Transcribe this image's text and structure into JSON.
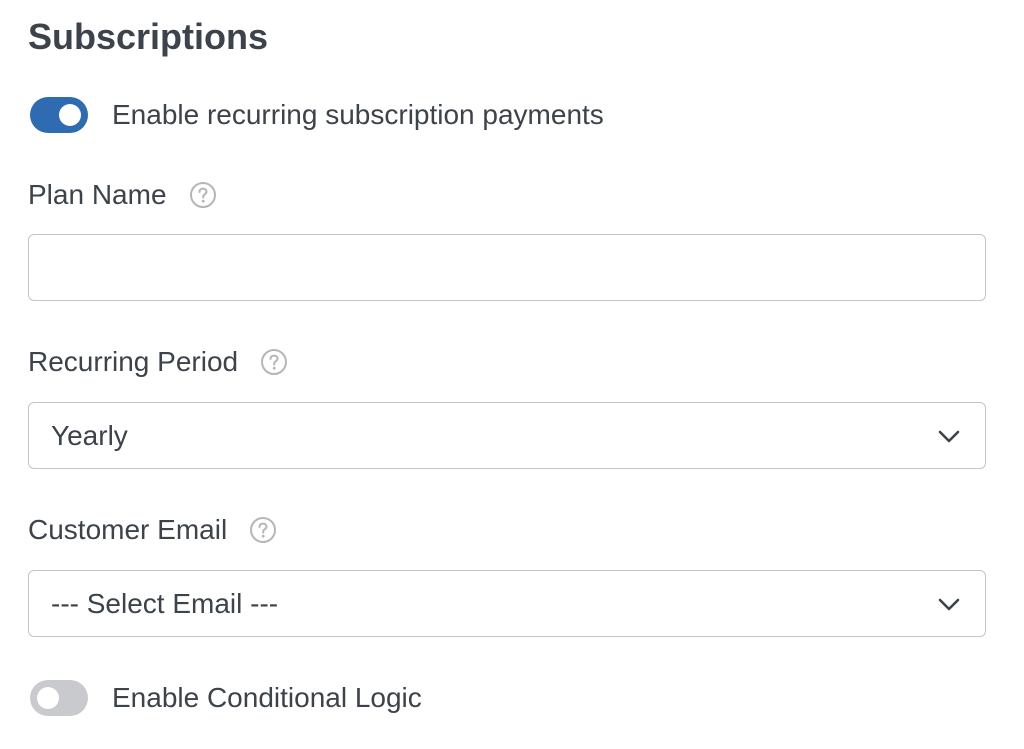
{
  "section": {
    "title": "Subscriptions"
  },
  "recurring_toggle": {
    "label": "Enable recurring subscription payments",
    "enabled": true
  },
  "plan_name": {
    "label": "Plan Name",
    "value": "",
    "placeholder": ""
  },
  "recurring_period": {
    "label": "Recurring Period",
    "selected": "Yearly"
  },
  "customer_email": {
    "label": "Customer Email",
    "selected": "--- Select Email ---"
  },
  "conditional_logic_toggle": {
    "label": "Enable Conditional Logic",
    "enabled": false
  },
  "icons": {
    "help": "question-circle-icon",
    "dropdown": "chevron-down-icon"
  },
  "colors": {
    "toggle_on": "#2e6bb0",
    "toggle_off": "#c8cacd",
    "text": "#3c434a",
    "border": "#c3c4c7"
  }
}
